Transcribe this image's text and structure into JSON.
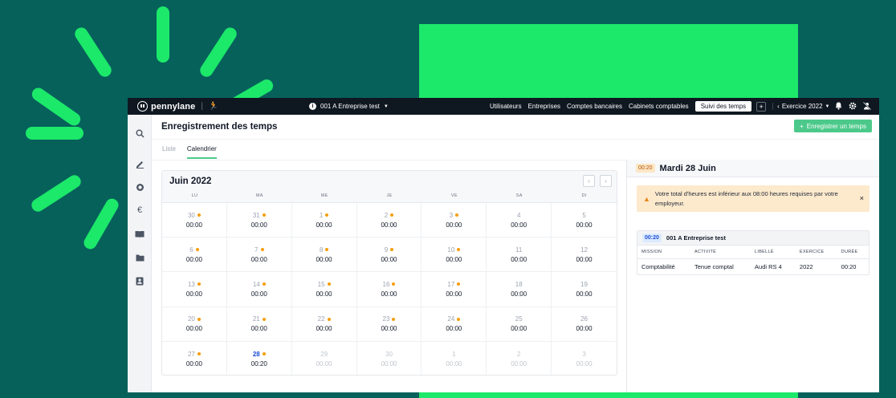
{
  "background": {
    "accent": "#1ce86a",
    "base": "#06615b"
  },
  "topbar": {
    "logo_text": "pennylane",
    "logo_divider": "|",
    "company_icon": "info-icon",
    "company_name": "001 A Entreprise test",
    "nav": [
      "Utilisateurs",
      "Entreprises",
      "Comptes bancaires",
      "Cabinets comptables"
    ],
    "suivi_button": "Suivi des temps",
    "plus_button": "+",
    "exercice_label": "Exercice 2022",
    "icons": [
      "bell-icon",
      "gear-icon",
      "user-off-icon"
    ]
  },
  "sidebar": {
    "icons": [
      "search-icon",
      "edit-icon",
      "target-icon",
      "euro-icon",
      "book-icon",
      "folder-icon",
      "contact-icon"
    ]
  },
  "page": {
    "title": "Enregistrement des temps",
    "add_button": "Enregistrer un temps",
    "tabs": [
      {
        "label": "Liste",
        "active": false
      },
      {
        "label": "Calendrier",
        "active": true
      }
    ]
  },
  "calendar": {
    "month": "Juin 2022",
    "weekdays": [
      "LU",
      "MA",
      "ME",
      "JE",
      "VE",
      "SA",
      "DI"
    ],
    "days": [
      {
        "day": "30",
        "time": "00:00",
        "dot": true,
        "state": "normal"
      },
      {
        "day": "31",
        "time": "00:00",
        "dot": true,
        "state": "normal"
      },
      {
        "day": "1",
        "time": "00:00",
        "dot": true,
        "state": "normal"
      },
      {
        "day": "2",
        "time": "00:00",
        "dot": true,
        "state": "normal"
      },
      {
        "day": "3",
        "time": "00:00",
        "dot": true,
        "state": "normal"
      },
      {
        "day": "4",
        "time": "00:00",
        "dot": false,
        "state": "normal"
      },
      {
        "day": "5",
        "time": "00:00",
        "dot": false,
        "state": "normal"
      },
      {
        "day": "6",
        "time": "00:00",
        "dot": true,
        "state": "normal"
      },
      {
        "day": "7",
        "time": "00:00",
        "dot": true,
        "state": "normal"
      },
      {
        "day": "8",
        "time": "00:00",
        "dot": true,
        "state": "normal"
      },
      {
        "day": "9",
        "time": "00:00",
        "dot": true,
        "state": "normal"
      },
      {
        "day": "10",
        "time": "00:00",
        "dot": true,
        "state": "normal"
      },
      {
        "day": "11",
        "time": "00:00",
        "dot": false,
        "state": "normal"
      },
      {
        "day": "12",
        "time": "00:00",
        "dot": false,
        "state": "normal"
      },
      {
        "day": "13",
        "time": "00:00",
        "dot": true,
        "state": "normal"
      },
      {
        "day": "14",
        "time": "00:00",
        "dot": true,
        "state": "normal"
      },
      {
        "day": "15",
        "time": "00:00",
        "dot": true,
        "state": "normal"
      },
      {
        "day": "16",
        "time": "00:00",
        "dot": true,
        "state": "normal"
      },
      {
        "day": "17",
        "time": "00:00",
        "dot": true,
        "state": "normal"
      },
      {
        "day": "18",
        "time": "00:00",
        "dot": false,
        "state": "normal"
      },
      {
        "day": "19",
        "time": "00:00",
        "dot": false,
        "state": "normal"
      },
      {
        "day": "20",
        "time": "00:00",
        "dot": true,
        "state": "normal"
      },
      {
        "day": "21",
        "time": "00:00",
        "dot": true,
        "state": "normal"
      },
      {
        "day": "22",
        "time": "00:00",
        "dot": true,
        "state": "normal"
      },
      {
        "day": "23",
        "time": "00:00",
        "dot": true,
        "state": "normal"
      },
      {
        "day": "24",
        "time": "00:00",
        "dot": true,
        "state": "normal"
      },
      {
        "day": "25",
        "time": "00:00",
        "dot": false,
        "state": "normal"
      },
      {
        "day": "26",
        "time": "00:00",
        "dot": false,
        "state": "normal"
      },
      {
        "day": "27",
        "time": "00:00",
        "dot": true,
        "state": "normal"
      },
      {
        "day": "28",
        "time": "00:20",
        "dot": true,
        "state": "today"
      },
      {
        "day": "29",
        "time": "00:00",
        "dot": false,
        "state": "faded"
      },
      {
        "day": "30",
        "time": "00:00",
        "dot": false,
        "state": "faded"
      },
      {
        "day": "1",
        "time": "00:00",
        "dot": false,
        "state": "faded"
      },
      {
        "day": "2",
        "time": "00:00",
        "dot": false,
        "state": "faded"
      },
      {
        "day": "3",
        "time": "00:00",
        "dot": false,
        "state": "faded"
      }
    ]
  },
  "detail": {
    "duration_badge": "00:20",
    "date": "Mardi 28 Juin",
    "alert_text": "Votre total d'heures est inférieur aux 08:00 heures requises par votre employeur.",
    "alert_close": "×",
    "entry": {
      "badge": "00:20",
      "company": "001 A Entreprise test",
      "columns": [
        "MISSION",
        "ACTIVITÉ",
        "LIBELLÉ",
        "EXERCICE",
        "DURÉE"
      ],
      "row": [
        "Comptabilité",
        "Tenue comptal",
        "Audi RS 4",
        "2022",
        "00:20"
      ]
    }
  }
}
